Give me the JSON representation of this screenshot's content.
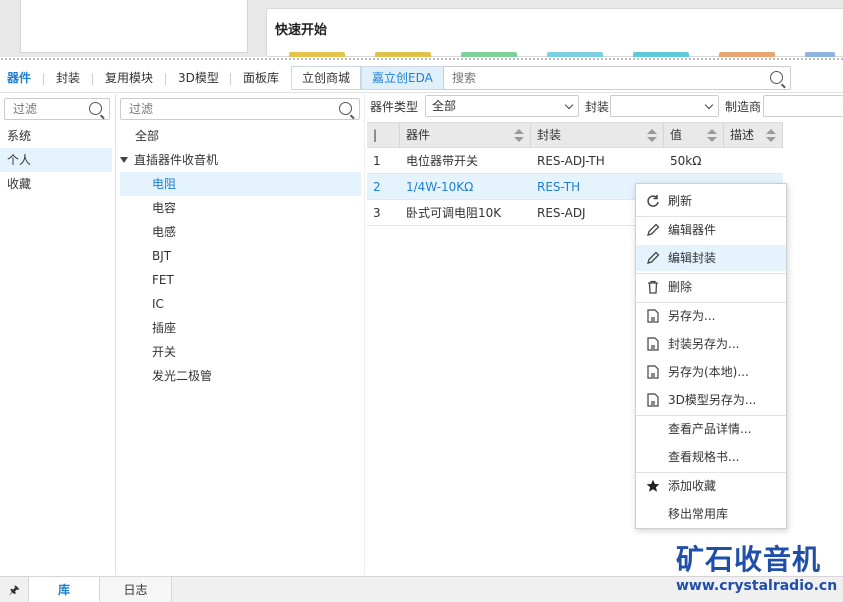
{
  "quick_start": {
    "title": "快速开始"
  },
  "top_tabs": {
    "items": [
      "器件",
      "封装",
      "复用模块",
      "3D模型",
      "面板库"
    ],
    "mall": "立创商城",
    "eda": "嘉立创EDA",
    "search_placeholder": "搜索"
  },
  "left_panel": {
    "filter_placeholder": "过滤",
    "items": [
      "系统",
      "个人",
      "收藏"
    ]
  },
  "tree": {
    "filter_placeholder": "过滤",
    "all": "全部",
    "group": "直插器件收音机",
    "children": [
      "电阻",
      "电容",
      "电感",
      "BJT",
      "FET",
      "IC",
      "插座",
      "开关",
      "发光二极管"
    ]
  },
  "filters": {
    "type_label": "器件类型",
    "type_value": "全部",
    "package_label": "封装",
    "package_value": "",
    "maker_label": "制造商"
  },
  "table": {
    "headers": [
      "|",
      "器件",
      "封装",
      "值",
      "描述"
    ],
    "rows": [
      {
        "no": "1",
        "name": "电位器带开关",
        "package": "RES-ADJ-TH",
        "value": "50kΩ",
        "desc": ""
      },
      {
        "no": "2",
        "name": "1/4W-10KΩ",
        "package": "RES-TH",
        "value": "",
        "desc": ""
      },
      {
        "no": "3",
        "name": "卧式可调电阻10K",
        "package": "RES-ADJ",
        "value": "",
        "desc": ""
      }
    ]
  },
  "context_menu": {
    "refresh": "刷新",
    "edit_part": "编辑器件",
    "edit_package": "编辑封装",
    "delete": "删除",
    "save_as": "另存为...",
    "package_save_as": "封装另存为...",
    "save_as_local": "另存为(本地)...",
    "model_save_as": "3D模型另存为...",
    "product_detail": "查看产品详情...",
    "datasheet": "查看规格书...",
    "add_favorite": "添加收藏",
    "remove_common": "移出常用库"
  },
  "bottom_tabs": {
    "pin": "🖈",
    "library": "库",
    "log": "日志"
  },
  "watermark": {
    "cn": "矿石收音机",
    "url": "www.crystalradio.cn"
  },
  "colors": {
    "accent": "#1e7fd6",
    "selection": "#e5f3fc",
    "watermark": "#1f4fa8"
  }
}
